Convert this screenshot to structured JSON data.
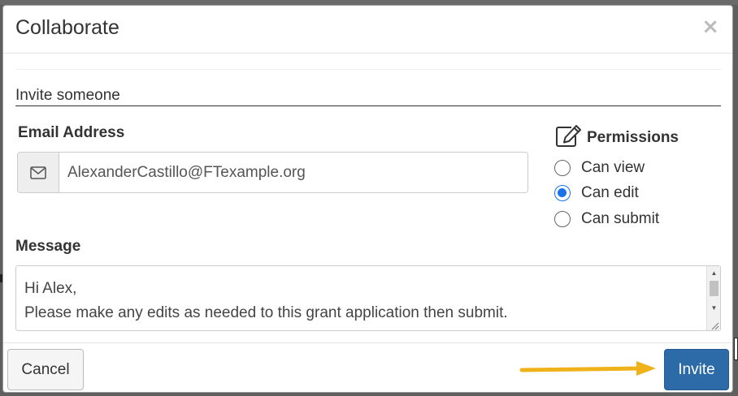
{
  "dialog": {
    "title": "Collaborate",
    "close_symbol": "×"
  },
  "invite": {
    "section_title": "Invite someone",
    "email_label": "Email Address",
    "email_value": "AlexanderCastillo@FTexample.org",
    "email_icon": "envelope-icon"
  },
  "permissions": {
    "title": "Permissions",
    "icon": "edit-icon",
    "options": [
      {
        "label": "Can view",
        "checked": false
      },
      {
        "label": "Can edit",
        "checked": true
      },
      {
        "label": "Can submit",
        "checked": false
      }
    ]
  },
  "message": {
    "label": "Message",
    "text": "Hi Alex,\nPlease make any edits as needed to this grant application then submit.\nThanks!"
  },
  "footer": {
    "cancel_label": "Cancel",
    "invite_label": "Invite"
  },
  "colors": {
    "accent": "#2c6aa8",
    "radio_checked": "#1a73e8",
    "annotation_arrow": "#f0b21a"
  }
}
